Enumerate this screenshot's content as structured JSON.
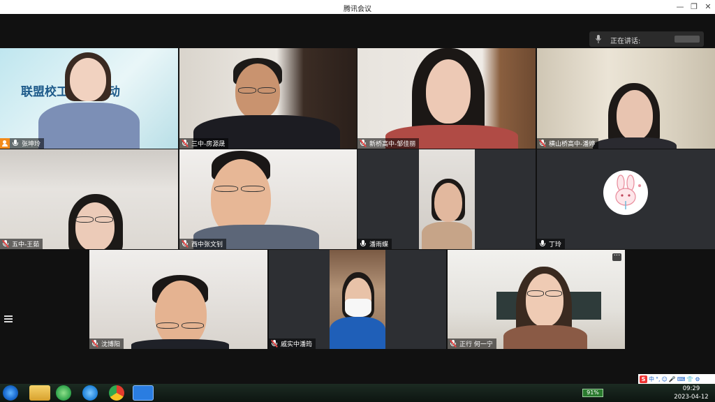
{
  "window": {
    "title": "腾讯会议",
    "minimize_icon": "minimize-icon",
    "restore_icon": "restore-icon",
    "close_icon": "close-icon"
  },
  "speaking_indicator": {
    "label": "正在讲话:"
  },
  "participants": [
    {
      "name": "张坤玲",
      "banner_text": "联盟校工  常规活动",
      "mic": "on",
      "host": true
    },
    {
      "name": "三中-房源晟",
      "mic": "off"
    },
    {
      "name": "新桥高中-邹佳丽",
      "mic": "off"
    },
    {
      "name": "横山桥高中-潘婷",
      "mic": "off"
    },
    {
      "name": "五中-王茹",
      "mic": "off"
    },
    {
      "name": "西中张文钊",
      "mic": "off"
    },
    {
      "name": "潘雨蝶",
      "mic": "on"
    },
    {
      "name": "丁玲",
      "mic": "on",
      "avatar": "rabbit-avatar"
    },
    {
      "name": "沈博阳",
      "mic": "off"
    },
    {
      "name": "戚实中潘筠",
      "mic": "off"
    },
    {
      "name": "正行 何一宁",
      "mic": "off"
    }
  ],
  "tile_menu": "···",
  "taskbar": {
    "apps": [
      "start-icon",
      "explorer-icon",
      "360-browser-icon",
      "ie-icon",
      "chrome-icon",
      "tencent-meeting-icon"
    ],
    "battery": "91%",
    "ime": [
      "中",
      "°,",
      "☺",
      "🎤",
      "⌨",
      "👕",
      "⚙"
    ],
    "time": "09:29",
    "date": "2023-04-12"
  }
}
